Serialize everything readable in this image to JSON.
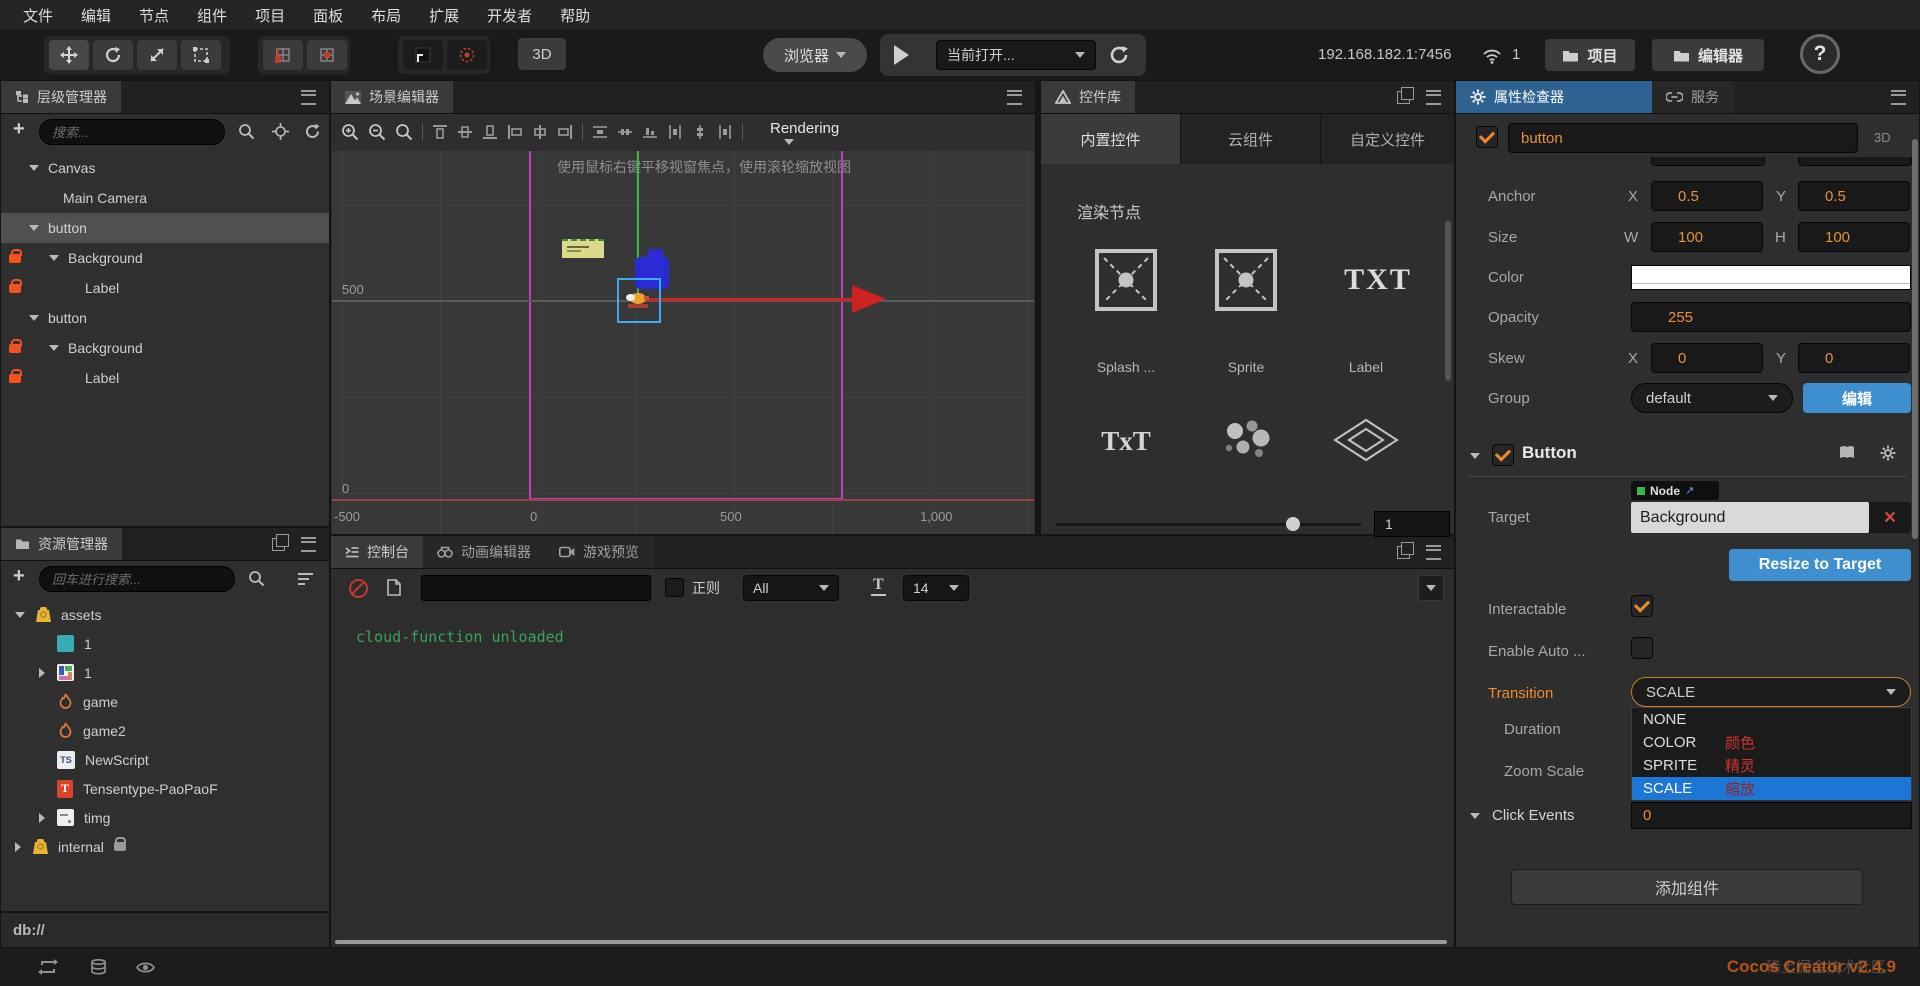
{
  "menu": {
    "items": [
      "文件",
      "编辑",
      "节点",
      "组件",
      "项目",
      "面板",
      "布局",
      "扩展",
      "开发者",
      "帮助"
    ]
  },
  "toolbar": {
    "view3d": "3D",
    "browser": "浏览器",
    "current_open": "当前打开...",
    "address": "192.168.182.1:7456",
    "device_count": "1",
    "project": "项目",
    "editor": "编辑器",
    "help": "?"
  },
  "hierarchy": {
    "title": "层级管理器",
    "add": "+",
    "search_placeholder": "搜索...",
    "nodes": [
      {
        "label": "Canvas"
      },
      {
        "label": "Main Camera"
      },
      {
        "label": "button"
      },
      {
        "label": "Background"
      },
      {
        "label": "Label"
      },
      {
        "label": "button"
      },
      {
        "label": "Background"
      },
      {
        "label": "Label"
      }
    ]
  },
  "assets": {
    "title": "资源管理器",
    "add": "+",
    "search_placeholder": "回车进行搜索...",
    "items": [
      {
        "label": "assets"
      },
      {
        "label": "1"
      },
      {
        "label": "1"
      },
      {
        "label": "game"
      },
      {
        "label": "game2"
      },
      {
        "label": "NewScript"
      },
      {
        "label": "Tensentype-PaoPaoF"
      },
      {
        "label": "timg"
      },
      {
        "label": "internal"
      }
    ],
    "path": "db://"
  },
  "scene": {
    "title": "场景编辑器",
    "rendering": "Rendering",
    "hint": "使用鼠标右键平移视窗焦点，使用滚轮缩放视图",
    "ruler_y": [
      "500",
      "0"
    ],
    "ruler_x": [
      "-500",
      "0",
      "500",
      "1,000"
    ]
  },
  "console": {
    "tabs": [
      "控制台",
      "动画编辑器",
      "游戏预览"
    ],
    "regex": "正则",
    "filter": "All",
    "fontsize": "14",
    "log": "cloud-function unloaded"
  },
  "widgets": {
    "title": "控件库",
    "tabs": [
      "内置控件",
      "云组件",
      "自定义控件"
    ],
    "section": "渲染节点",
    "labels": [
      "Splash ...",
      "Sprite",
      "Label"
    ],
    "txt_icon": "TXT",
    "txt2_icon": "TxT",
    "slider_value": "1"
  },
  "inspector": {
    "tab": "属性检查器",
    "tab2": "服务",
    "node_name": "button",
    "mode": "3D",
    "anchor": {
      "label": "Anchor",
      "x_label": "X",
      "x": "0.5",
      "y_label": "Y",
      "y": "0.5"
    },
    "size": {
      "label": "Size",
      "w_label": "W",
      "w": "100",
      "h_label": "H",
      "h": "100"
    },
    "color_label": "Color",
    "opacity": {
      "label": "Opacity",
      "value": "255"
    },
    "skew": {
      "label": "Skew",
      "x_label": "X",
      "x": "0",
      "y_label": "Y",
      "y": "0"
    },
    "group": {
      "label": "Group",
      "value": "default",
      "edit": "编辑"
    },
    "button": {
      "title": "Button",
      "target_label": "Target",
      "target_tag": "Node",
      "target_value": "Background",
      "resize": "Resize to Target",
      "interactable": "Interactable",
      "enable_auto": "Enable Auto ...",
      "transition": "Transition",
      "transition_value": "SCALE",
      "options": [
        {
          "en": "NONE",
          "zh": ""
        },
        {
          "en": "COLOR",
          "zh": "颜色"
        },
        {
          "en": "SPRITE",
          "zh": "精灵"
        },
        {
          "en": "SCALE",
          "zh": "缩放"
        }
      ],
      "duration": "Duration",
      "zoom_scale": "Zoom Scale",
      "click_events": "Click Events",
      "click_events_value": "0"
    },
    "add_component": "添加组件"
  },
  "statusbar": {
    "version": "Cocos Creator v2.4.9",
    "watermark": "稀土掘金技术社区"
  }
}
